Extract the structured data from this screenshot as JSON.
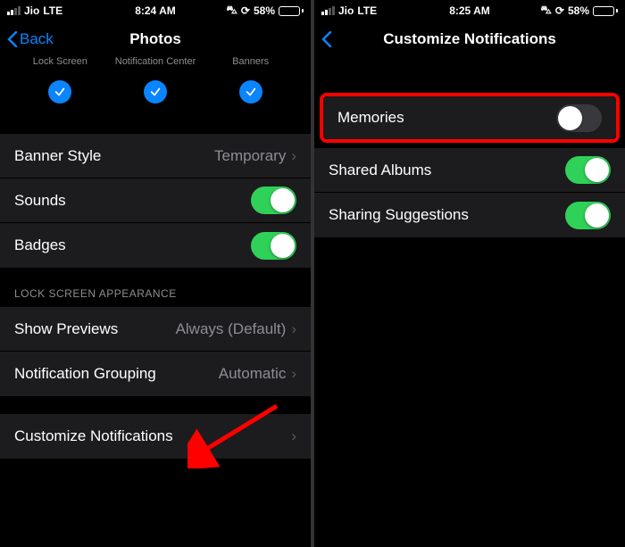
{
  "left": {
    "status": {
      "carrier": "Jio",
      "net": "LTE",
      "time": "8:24 AM",
      "battery_pct": "58%",
      "driving_icon": "car",
      "orientation_lock": true
    },
    "nav": {
      "back": "Back",
      "title": "Photos"
    },
    "alert_options": {
      "opt1": "Lock Screen",
      "opt2": "Notification Center",
      "opt3": "Banners"
    },
    "rows": {
      "banner_style": {
        "label": "Banner Style",
        "value": "Temporary"
      },
      "sounds": {
        "label": "Sounds",
        "on": true
      },
      "badges": {
        "label": "Badges",
        "on": true
      }
    },
    "section_lock": "LOCK SCREEN APPEARANCE",
    "show_previews": {
      "label": "Show Previews",
      "value": "Always (Default)"
    },
    "grouping": {
      "label": "Notification Grouping",
      "value": "Automatic"
    },
    "customize": {
      "label": "Customize Notifications"
    }
  },
  "right": {
    "status": {
      "carrier": "Jio",
      "net": "LTE",
      "time": "8:25 AM",
      "battery_pct": "58%"
    },
    "nav": {
      "title": "Customize Notifications"
    },
    "rows": {
      "memories": {
        "label": "Memories",
        "on": false
      },
      "shared_albums": {
        "label": "Shared Albums",
        "on": true
      },
      "sharing_suggestions": {
        "label": "Sharing Suggestions",
        "on": true
      }
    }
  }
}
